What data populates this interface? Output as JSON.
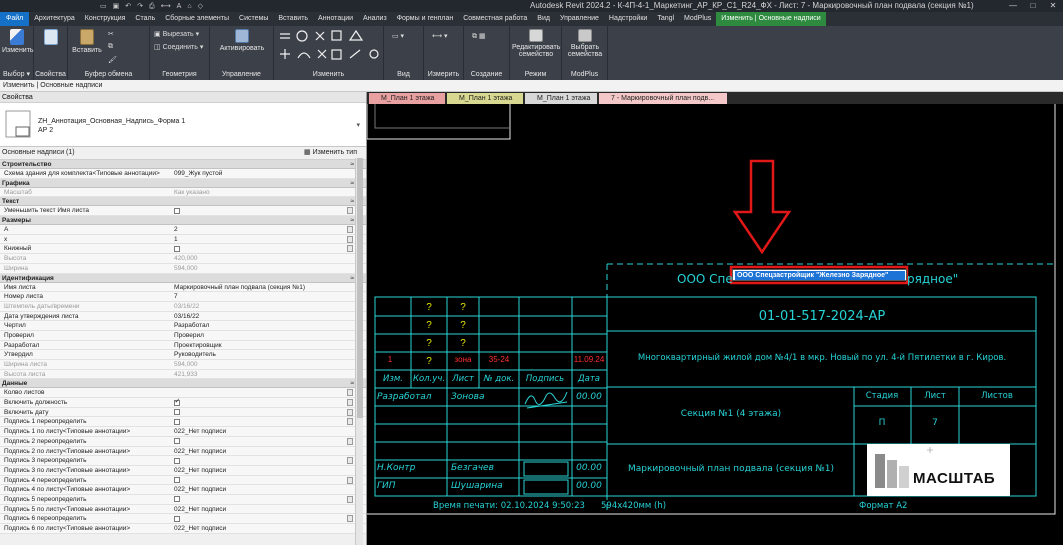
{
  "titlebar": {
    "title": "Autodesk Revit 2024.2 - К-4П-4-1_Маркетинг_АР_КР_С1_R24_ФХ - Лист: 7 - Маркировочный план подвала (секция №1)",
    "minimize": "—",
    "maximize": "□",
    "close": "✕"
  },
  "menu": [
    "Файл",
    "Архитектура",
    "Конструкция",
    "Сталь",
    "Сборные элементы",
    "Системы",
    "Вставить",
    "Аннотации",
    "Анализ",
    "Формы и генплан",
    "Совместная работа",
    "Вид",
    "Управление",
    "Надстройки",
    "Tangl",
    "ModPlus",
    "Изменить | Основные надписи"
  ],
  "ribbon": {
    "modify": "Изменить",
    "select": "Выбор ▾",
    "properties": "Свойства",
    "paste": "Вставить",
    "clipboard": "Буфер обмена",
    "cut": "Вырезать",
    "join": "Соединить",
    "geometry": "Геометрия",
    "activate": "Активировать",
    "manage": "Управление",
    "modify_group": "Изменить",
    "view": "Вид",
    "measure": "Измерить",
    "create": "Создание",
    "edit_family": "Редактировать семейство",
    "mode": "Режим",
    "select_families": "Выбрать семейства",
    "modplus": "ModPlus"
  },
  "context_bar": "Изменить | Основные надписи",
  "properties": {
    "header": "Свойства",
    "type_name": "ZH_Аннотация_Основная_Надпись_Форма 1",
    "type_sub": "АР 2",
    "instance": "Основные надписи (1)",
    "edit_type": "Изменить тип",
    "categories": [
      {
        "name": "Строительство",
        "rows": [
          {
            "n": "Схема здания для комплекта<Типовые аннотации>",
            "v": "099_Жук пустой"
          }
        ]
      },
      {
        "name": "Графика",
        "rows": [
          {
            "n": "Масштаб",
            "v": "Как указано",
            "dim": true
          }
        ]
      },
      {
        "name": "Текст",
        "rows": [
          {
            "n": "Уменьшить текст Имя листа",
            "chk": false,
            "ed": true
          }
        ]
      },
      {
        "name": "Размеры",
        "rows": [
          {
            "n": "A",
            "v": "2",
            "ed": true
          },
          {
            "n": "x",
            "v": "1",
            "ed": true
          },
          {
            "n": "Книжный",
            "chk": false,
            "ed": true
          },
          {
            "n": "Высота",
            "v": "420,000",
            "dim": true
          },
          {
            "n": "Ширина",
            "v": "594,000",
            "dim": true
          }
        ]
      },
      {
        "name": "Идентификация",
        "rows": [
          {
            "n": "Имя листа",
            "v": "Маркировочный план подвала (секция №1)"
          },
          {
            "n": "Номер листа",
            "v": "7"
          },
          {
            "n": "Штемпель даты/времени",
            "v": "03/16/22",
            "dim": true
          },
          {
            "n": "Дата утверждения листа",
            "v": "03/16/22"
          },
          {
            "n": "Чертил",
            "v": "Разработал"
          },
          {
            "n": "Проверил",
            "v": "Проверил"
          },
          {
            "n": "Разработал",
            "v": "Проектировщик"
          },
          {
            "n": "Утвердил",
            "v": "Руководитель"
          },
          {
            "n": "Ширина листа",
            "v": "594,000",
            "dim": true
          },
          {
            "n": "Высота листа",
            "v": "421,933",
            "dim": true
          }
        ]
      },
      {
        "name": "Данные",
        "rows": [
          {
            "n": "Колво листов",
            "ed": true
          },
          {
            "n": "Включить должность",
            "chk": true,
            "ed": true
          },
          {
            "n": "Включить дату",
            "chk": false,
            "ed": true
          },
          {
            "n": "Подпись 1 переопределить",
            "chk": false,
            "ed": true
          },
          {
            "n": "Подпись 1 по листу<Типовые аннотации>",
            "v": "022_Нет подписи"
          },
          {
            "n": "Подпись 2 переопределить",
            "chk": false,
            "ed": true
          },
          {
            "n": "Подпись 2 по листу<Типовые аннотации>",
            "v": "022_Нет подписи"
          },
          {
            "n": "Подпись 3 переопределить",
            "chk": false,
            "ed": true
          },
          {
            "n": "Подпись 3 по листу<Типовые аннотации>",
            "v": "022_Нет подписи"
          },
          {
            "n": "Подпись 4 переопределить",
            "chk": false,
            "ed": true
          },
          {
            "n": "Подпись 4 по листу<Типовые аннотации>",
            "v": "022_Нет подписи"
          },
          {
            "n": "Подпись 5 переопределить",
            "chk": false,
            "ed": true
          },
          {
            "n": "Подпись 5 по листу<Типовые аннотации>",
            "v": "022_Нет подписи"
          },
          {
            "n": "Подпись 6 переопределить",
            "chk": false,
            "ed": true
          },
          {
            "n": "Подпись 6 по листу<Типовые аннотации>",
            "v": "022_Нет подписи"
          }
        ]
      }
    ],
    "value_col": "≈"
  },
  "tabs": [
    {
      "label": "М_План 1 этажа",
      "color": "#e8a0a0"
    },
    {
      "label": "М_План 1 этажа",
      "color": "#d8d890"
    },
    {
      "label": "М_План 1 этажа",
      "color": "#d8d8d8"
    },
    {
      "label": "7 - Маркировочный план подв...",
      "color": "#f4c8c8",
      "active": true
    }
  ],
  "sheet": {
    "edit_text": "ООО Спецзастройщик \"Железно Зарядное\"",
    "org_left": "ООО Спе",
    "org_right": "рядное\"",
    "code": "01-01-517-2024-АР",
    "project": "Многоквартирный жилой дом №4/1 в мкр. Новый по ул. 4-й Пятилетки в г. Киров.",
    "section": "Секция №1 (4 этажа)",
    "sheet_title": "Маркировочный план подвала (секция №1)",
    "stage_h": "Стадия",
    "sheet_h": "Лист",
    "sheets_h": "Листов",
    "stage": "П",
    "sheet_no": "7",
    "q": "?",
    "rev_row": {
      "n": "1",
      "q": "?",
      "sheet": "зона",
      "doc": "35-24",
      "date": "11.09.24"
    },
    "cols": [
      "Изм.",
      "Кол.уч.",
      "Лист",
      "№ док.",
      "Подпись",
      "Дата"
    ],
    "people": [
      {
        "role": "Разработал",
        "name": "Зонова",
        "date": "00.00"
      },
      {
        "role": "Н.Контр",
        "name": "Безгачев",
        "date": "00.00"
      },
      {
        "role": "ГИП",
        "name": "Шушарина",
        "date": "00.00"
      }
    ],
    "print_time": "Время печати: 02.10.2024  9:50:23",
    "size": "594x420мм (h)",
    "format": "Формат А2",
    "logo_text": "МАСШТАБ"
  }
}
